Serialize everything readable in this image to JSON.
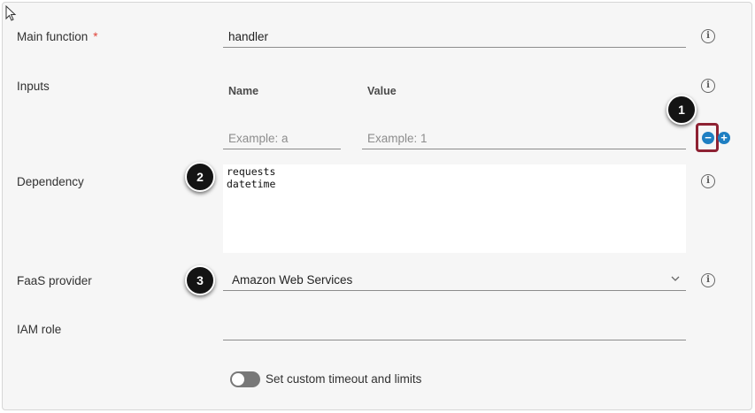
{
  "form": {
    "main_function": {
      "label": "Main function",
      "required_mark": "*",
      "value": "handler",
      "info_icon": "info-icon"
    },
    "inputs": {
      "label": "Inputs",
      "name_header": "Name",
      "value_header": "Value",
      "name_placeholder": "Example: a",
      "value_placeholder": "Example: 1",
      "remove_symbol": "−",
      "add_symbol": "+",
      "info_icon": "info-icon"
    },
    "dependency": {
      "label": "Dependency",
      "value": "requests\ndatetime",
      "info_icon": "info-icon"
    },
    "faas_provider": {
      "label": "FaaS provider",
      "selected": "Amazon Web Services",
      "chevron_icon": "chevron-down-icon",
      "info_icon": "info-icon"
    },
    "iam_role": {
      "label": "IAM role",
      "value": ""
    },
    "custom_timeout": {
      "label": "Set custom timeout and limits",
      "enabled": false
    },
    "info_glyph": "i"
  },
  "callouts": [
    "1",
    "2",
    "3"
  ],
  "colors": {
    "accent": "#1f7fc2",
    "required": "#e0453a",
    "highlight": "#8e2233",
    "toggle_off": "#787878"
  }
}
